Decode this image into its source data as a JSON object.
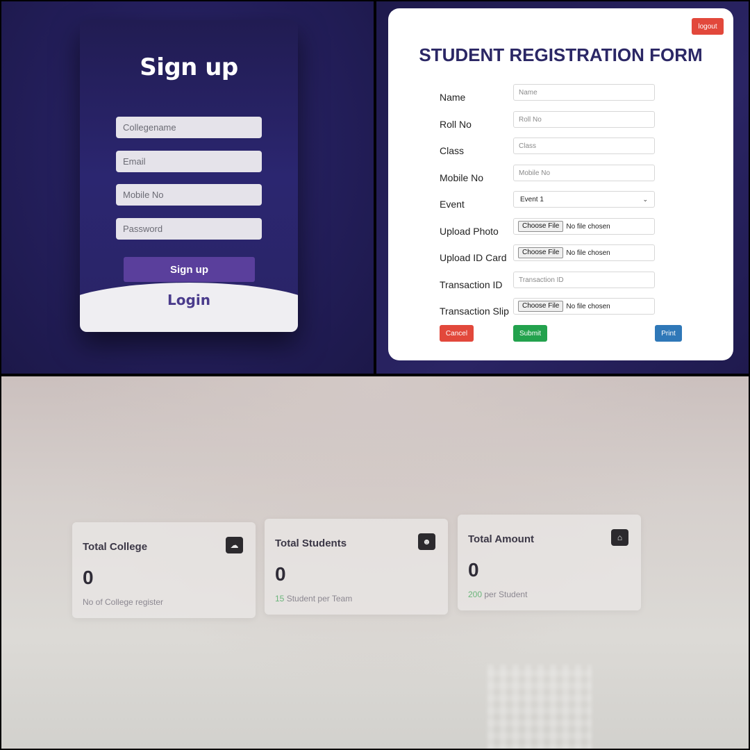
{
  "signup": {
    "title": "Sign up",
    "fields": [
      {
        "placeholder": "Collegename"
      },
      {
        "placeholder": "Email"
      },
      {
        "placeholder": "Mobile No"
      },
      {
        "placeholder": "Password"
      }
    ],
    "submit_label": "Sign up",
    "login_label": "Login"
  },
  "registration": {
    "logout_label": "logout",
    "title": "STUDENT REGISTRATION FORM",
    "fields": [
      {
        "label": "Name",
        "placeholder": "Name"
      },
      {
        "label": "Roll No",
        "placeholder": "Roll No"
      },
      {
        "label": "Class",
        "placeholder": "Class"
      },
      {
        "label": "Mobile No",
        "placeholder": "Mobile No"
      },
      {
        "label": "Event",
        "value": "Event 1"
      },
      {
        "label": "Upload Photo",
        "button": "Choose File",
        "status": "No file chosen"
      },
      {
        "label": "Upload ID Card",
        "button": "Choose File",
        "status": "No file chosen"
      },
      {
        "label": "Transaction ID",
        "placeholder": "Transaction ID"
      },
      {
        "label": "Transaction Slip",
        "button": "Choose File",
        "status": "No file chosen"
      }
    ],
    "buttons": {
      "cancel": "Cancel",
      "submit": "Submit",
      "print": "Print"
    },
    "colors": {
      "cancel": "#e2483b",
      "submit": "#23a24d",
      "print": "#2f78b8",
      "title": "#2b2765"
    }
  },
  "dashboard": {
    "cards": [
      {
        "title": "Total College",
        "value": "0",
        "sub_accent": "",
        "sub_text": "No of College register",
        "icon": "cloud-icon"
      },
      {
        "title": "Total Students",
        "value": "0",
        "sub_accent": "15",
        "sub_text": " Student per Team",
        "icon": "student-icon"
      },
      {
        "title": "Total Amount",
        "value": "0",
        "sub_accent": "200",
        "sub_text": " per Student",
        "icon": "money-icon"
      }
    ]
  }
}
